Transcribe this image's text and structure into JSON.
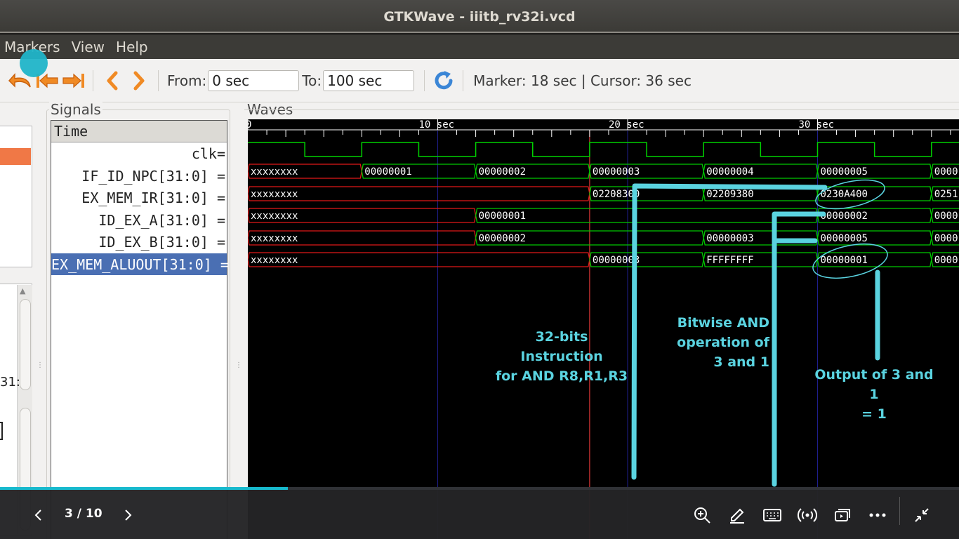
{
  "window": {
    "title": "GTKWave - iiitb_rv32i.vcd"
  },
  "menubar": {
    "items": [
      "Markers",
      "View",
      "Help"
    ]
  },
  "toolbar": {
    "from_label": "From:",
    "from_value": "0 sec",
    "to_label": "To:",
    "to_value": "100 sec",
    "marker_text": "Marker: 18 sec  |  Cursor: 36 sec",
    "icons": [
      "undo-icon",
      "jump-start-icon",
      "jump-end-icon",
      "prev-icon",
      "next-icon",
      "reload-icon"
    ]
  },
  "left_pane": {
    "fragment_text": "31:"
  },
  "signals": {
    "title": "Signals",
    "header": "Time",
    "rows": [
      {
        "name": "clk="
      },
      {
        "name": "IF_ID_NPC[31:0] ="
      },
      {
        "name": "EX_MEM_IR[31:0] ="
      },
      {
        "name": "ID_EX_A[31:0] ="
      },
      {
        "name": "ID_EX_B[31:0] ="
      },
      {
        "name": "EX_MEM_ALUOUT[31:0] ="
      }
    ],
    "selected_row": 5
  },
  "waves": {
    "title": "Waves",
    "time_labels": [
      "0",
      "10 sec",
      "20 sec",
      "30 sec"
    ],
    "bus_values": {
      "IF_ID_NPC": [
        "xxxxxxxx",
        "00000001",
        "00000002",
        "00000003",
        "00000004",
        "00000005",
        "0000"
      ],
      "EX_MEM_IR": [
        "xxxxxxxx",
        "02208300",
        "02209380",
        "0230A400",
        "0251"
      ],
      "ID_EX_A": [
        "xxxxxxxx",
        "00000001",
        "00000002",
        "0000"
      ],
      "ID_EX_B": [
        "xxxxxxxx",
        "00000002",
        "00000003",
        "00000005",
        "0000"
      ],
      "EX_MEM_ALUOUT": [
        "xxxxxxxx",
        "00000003",
        "FFFFFFFF",
        "00000001",
        "0000"
      ]
    },
    "colors": {
      "clock": "#00d000",
      "valid": "#00c800",
      "undefined": "#e01818",
      "cursor": "#ff4040",
      "marker": "#5a5ad8",
      "annotation": "#5ad3e0"
    }
  },
  "annotations": {
    "instr_line1": "32-bits Instruction",
    "instr_line2": "for AND R8,R1,R3",
    "and_line1": "Bitwise AND",
    "and_line2": "operation of",
    "and_line3": "3 and 1",
    "out_line1": "Output of 3 and 1",
    "out_line2": "= 1"
  },
  "player": {
    "page": "3 / 10",
    "progress_percent": 30,
    "icons": [
      "prev-page-icon",
      "next-page-icon",
      "zoom-in-icon",
      "pen-icon",
      "keyboard-icon",
      "broadcast-icon",
      "present-icon",
      "more-icon",
      "collapse-icon"
    ]
  }
}
